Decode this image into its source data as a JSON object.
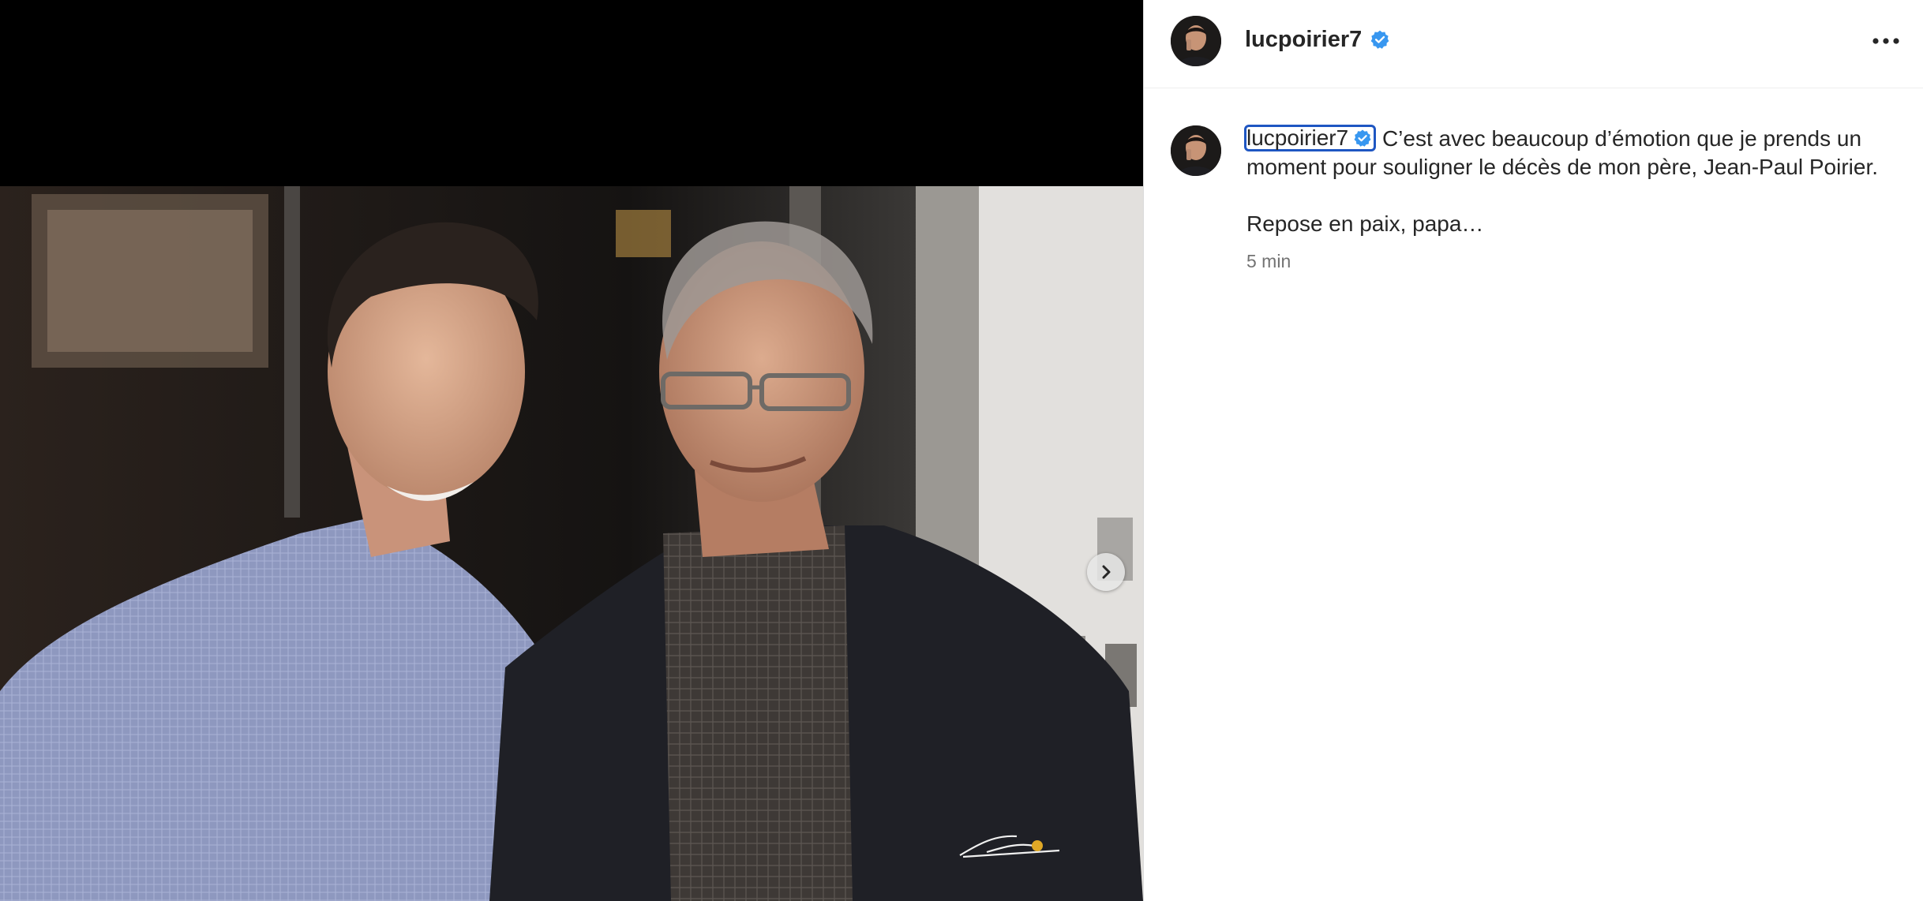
{
  "post": {
    "username": "lucpoirier7",
    "verified": true,
    "caption_text": "C’est avec beaucoup d’émotion que je prends un moment pour souligner le décès de mon père, Jean-Paul Poirier.",
    "caption_line2": "Repose en paix, papa…",
    "timestamp": "5 min"
  },
  "colors": {
    "verified_badge": "#3897f0",
    "focus_outline": "#1e56c2",
    "text_primary": "#262626",
    "text_secondary": "#737373"
  },
  "icons": {
    "more": "more-horizontal-icon",
    "next": "chevron-right-icon",
    "verified": "verified-badge-icon"
  }
}
